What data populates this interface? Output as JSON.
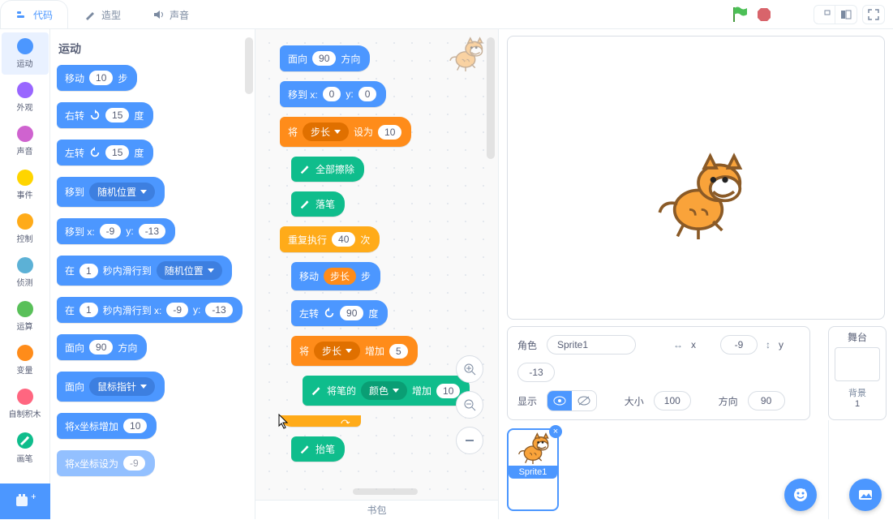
{
  "tabs": {
    "code": "代码",
    "costumes": "造型",
    "sounds": "声音"
  },
  "categories": [
    {
      "id": "motion",
      "label": "运动",
      "color": "#4c97ff"
    },
    {
      "id": "looks",
      "label": "外观",
      "color": "#9966ff"
    },
    {
      "id": "sound",
      "label": "声音",
      "color": "#cf63cf"
    },
    {
      "id": "events",
      "label": "事件",
      "color": "#ffbf00"
    },
    {
      "id": "control",
      "label": "控制",
      "color": "#ffab19"
    },
    {
      "id": "sensing",
      "label": "侦测",
      "color": "#5cb1d6"
    },
    {
      "id": "operators",
      "label": "运算",
      "color": "#59c059"
    },
    {
      "id": "variables",
      "label": "变量",
      "color": "#ff8c1a"
    },
    {
      "id": "myblocks",
      "label": "自制积木",
      "color": "#ff6680"
    },
    {
      "id": "pen",
      "label": "画笔",
      "color": "#0fbd8c",
      "iconOnly": true
    }
  ],
  "palette": {
    "heading": "运动",
    "blocks": {
      "move": {
        "pre": "移动",
        "val": "10",
        "post": "步"
      },
      "turn_cw": {
        "pre": "右转",
        "val": "15",
        "post": "度"
      },
      "turn_ccw": {
        "pre": "左转",
        "val": "15",
        "post": "度"
      },
      "goto_menu": {
        "pre": "移到",
        "menu": "随机位置"
      },
      "goto_xy": {
        "pre": "移到 x:",
        "x": "-9",
        "mid": "y:",
        "y": "-13"
      },
      "glide_menu": {
        "pre": "在",
        "secs": "1",
        "mid": "秒内滑行到",
        "menu": "随机位置"
      },
      "glide_xy": {
        "pre": "在",
        "secs": "1",
        "mid": "秒内滑行到 x:",
        "x": "-9",
        "mid2": "y:",
        "y": "-13"
      },
      "point_dir": {
        "pre": "面向",
        "val": "90",
        "post": "方向"
      },
      "point_to": {
        "pre": "面向",
        "menu": "鼠标指针"
      },
      "change_x": {
        "pre": "将x坐标增加",
        "val": "10"
      },
      "set_x": {
        "pre": "将x坐标设为",
        "val": "-9"
      }
    }
  },
  "script": {
    "point_dir": {
      "pre": "面向",
      "val": "90",
      "post": "方向"
    },
    "goto_xy": {
      "pre": "移到 x:",
      "x": "0",
      "mid": "y:",
      "y": "0"
    },
    "set_var": {
      "pre": "将",
      "var": "步长",
      "mid": "设为",
      "val": "10"
    },
    "pen_clear": {
      "label": "全部擦除"
    },
    "pen_down": {
      "label": "落笔"
    },
    "repeat": {
      "pre": "重复执行",
      "val": "40",
      "post": "次"
    },
    "move_var": {
      "pre": "移动",
      "var": "步长",
      "post": "步"
    },
    "turn_ccw": {
      "pre": "左转",
      "val": "90",
      "post": "度"
    },
    "change_var": {
      "pre": "将",
      "var": "步长",
      "mid": "增加",
      "val": "5"
    },
    "pen_color": {
      "pre": "将笔的",
      "menu": "颜色",
      "mid": "增加",
      "val": "10"
    },
    "pen_up": {
      "label": "抬笔"
    }
  },
  "backpack": "书包",
  "sprite_panel": {
    "name_lbl": "角色",
    "name": "Sprite1",
    "x_lbl": "x",
    "x": "-9",
    "y_lbl": "y",
    "y": "-13",
    "show_lbl": "显示",
    "size_lbl": "大小",
    "size": "100",
    "dir_lbl": "方向",
    "dir": "90"
  },
  "stage_panel": {
    "title": "舞台",
    "bg_lbl": "背景",
    "bg_count": "1"
  },
  "sprite_thumb": {
    "name": "Sprite1"
  }
}
